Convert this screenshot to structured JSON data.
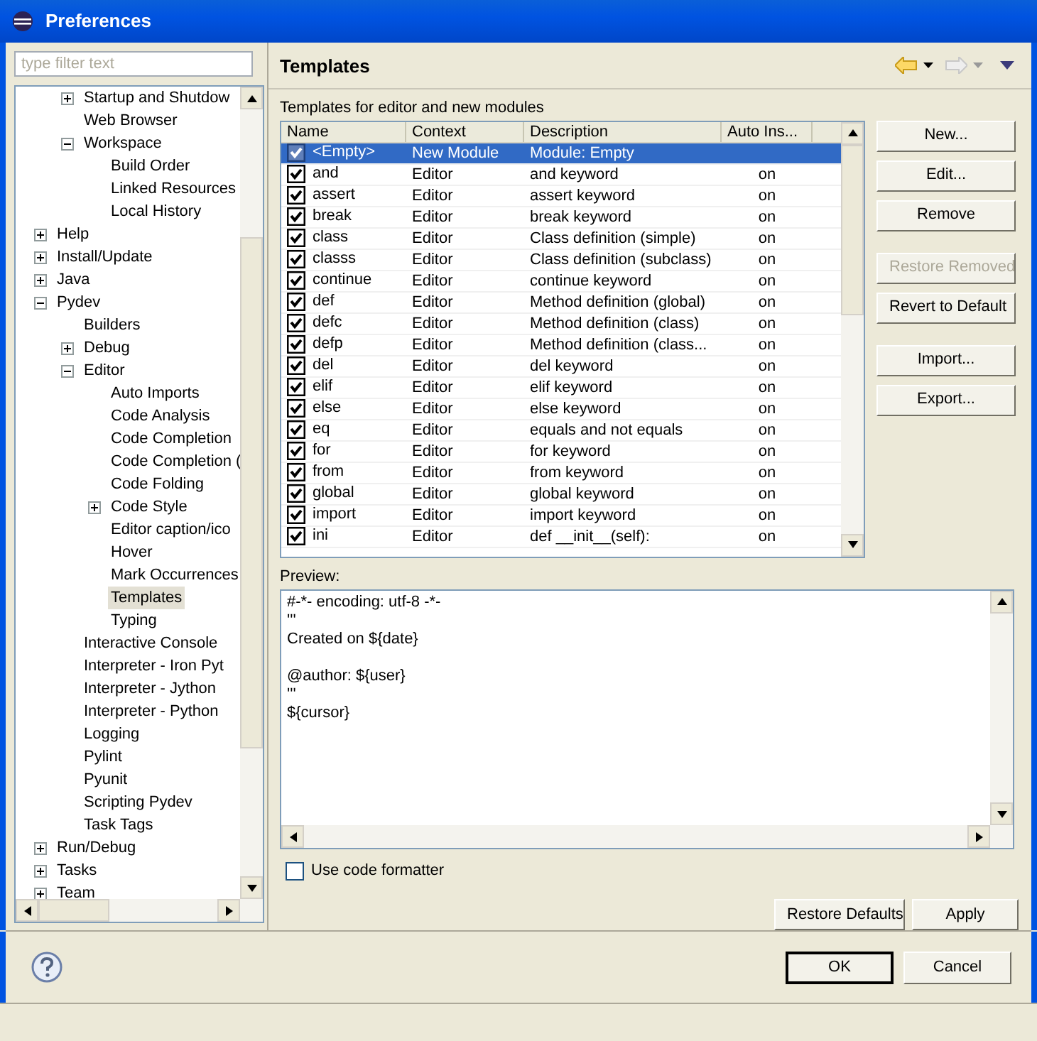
{
  "window": {
    "title": "Preferences"
  },
  "filter": {
    "placeholder": "type filter text"
  },
  "tree": [
    {
      "children": [
        {
          "label": "Startup and Shutdow",
          "expanded": false
        },
        {
          "label": "Web Browser"
        },
        {
          "label": "Workspace",
          "expanded": true,
          "children": [
            {
              "label": "Build Order"
            },
            {
              "label": "Linked Resources"
            },
            {
              "label": "Local History"
            }
          ]
        }
      ]
    },
    {
      "label": "Help",
      "expanded": false
    },
    {
      "label": "Install/Update",
      "expanded": false
    },
    {
      "label": "Java",
      "expanded": false
    },
    {
      "label": "Pydev",
      "expanded": true,
      "children": [
        {
          "label": "Builders"
        },
        {
          "label": "Debug",
          "expanded": false
        },
        {
          "label": "Editor",
          "expanded": true,
          "children": [
            {
              "label": "Auto Imports",
              "selected": false
            },
            {
              "label": "Code Analysis",
              "selected": false
            },
            {
              "label": "Code Completion",
              "selected": false
            },
            {
              "label": "Code Completion (",
              "selected": false
            },
            {
              "label": "Code Folding",
              "selected": false
            },
            {
              "label": "Code Style",
              "expanded": false,
              "selected": false
            },
            {
              "label": "Editor caption/ico",
              "selected": false
            },
            {
              "label": "Hover",
              "selected": false
            },
            {
              "label": "Mark Occurrences",
              "selected": false
            },
            {
              "label": "Templates",
              "selected": true
            },
            {
              "label": "Typing",
              "selected": false
            }
          ]
        },
        {
          "label": "Interactive Console"
        },
        {
          "label": "Interpreter - Iron Pyt"
        },
        {
          "label": "Interpreter - Jython"
        },
        {
          "label": "Interpreter - Python"
        },
        {
          "label": "Logging"
        },
        {
          "label": "Pylint"
        },
        {
          "label": "Pyunit"
        },
        {
          "label": "Scripting Pydev"
        },
        {
          "label": "Task Tags"
        }
      ]
    },
    {
      "label": "Run/Debug",
      "expanded": false
    },
    {
      "label": "Tasks",
      "expanded": false
    },
    {
      "label": "Team",
      "expanded": false
    }
  ],
  "page": {
    "title": "Templates",
    "description": "Templates for editor and new modules"
  },
  "table": {
    "columns": [
      "Name",
      "Context",
      "Description",
      "Auto Ins..."
    ],
    "rows": [
      {
        "name": "<Empty>",
        "context": "New Module",
        "description": "Module: Empty",
        "auto": "",
        "checked": true,
        "selected": true
      },
      {
        "name": "and",
        "context": "Editor",
        "description": "and keyword",
        "auto": "on",
        "checked": true,
        "selected": false
      },
      {
        "name": "assert",
        "context": "Editor",
        "description": "assert keyword",
        "auto": "on",
        "checked": true,
        "selected": false
      },
      {
        "name": "break",
        "context": "Editor",
        "description": "break keyword",
        "auto": "on",
        "checked": true,
        "selected": false
      },
      {
        "name": "class",
        "context": "Editor",
        "description": "Class definition (simple)",
        "auto": "on",
        "checked": true,
        "selected": false
      },
      {
        "name": "classs",
        "context": "Editor",
        "description": "Class definition (subclass)",
        "auto": "on",
        "checked": true,
        "selected": false
      },
      {
        "name": "continue",
        "context": "Editor",
        "description": "continue keyword",
        "auto": "on",
        "checked": true,
        "selected": false
      },
      {
        "name": "def",
        "context": "Editor",
        "description": "Method definition (global)",
        "auto": "on",
        "checked": true,
        "selected": false
      },
      {
        "name": "defc",
        "context": "Editor",
        "description": "Method definition (class)",
        "auto": "on",
        "checked": true,
        "selected": false
      },
      {
        "name": "defp",
        "context": "Editor",
        "description": "Method definition (class...",
        "auto": "on",
        "checked": true,
        "selected": false
      },
      {
        "name": "del",
        "context": "Editor",
        "description": "del keyword",
        "auto": "on",
        "checked": true,
        "selected": false
      },
      {
        "name": "elif",
        "context": "Editor",
        "description": "elif keyword",
        "auto": "on",
        "checked": true,
        "selected": false
      },
      {
        "name": "else",
        "context": "Editor",
        "description": "else keyword",
        "auto": "on",
        "checked": true,
        "selected": false
      },
      {
        "name": "eq",
        "context": "Editor",
        "description": "equals and not equals",
        "auto": "on",
        "checked": true,
        "selected": false
      },
      {
        "name": "for",
        "context": "Editor",
        "description": "for keyword",
        "auto": "on",
        "checked": true,
        "selected": false
      },
      {
        "name": "from",
        "context": "Editor",
        "description": "from keyword",
        "auto": "on",
        "checked": true,
        "selected": false
      },
      {
        "name": "global",
        "context": "Editor",
        "description": "global keyword",
        "auto": "on",
        "checked": true,
        "selected": false
      },
      {
        "name": "import",
        "context": "Editor",
        "description": "import keyword",
        "auto": "on",
        "checked": true,
        "selected": false
      },
      {
        "name": "ini",
        "context": "Editor",
        "description": "def __init__(self):",
        "auto": "on",
        "checked": true,
        "selected": false
      }
    ]
  },
  "side_button_groups": [
    [
      {
        "label": "New...",
        "disabled": false
      },
      {
        "label": "Edit...",
        "disabled": false
      },
      {
        "label": "Remove",
        "disabled": false
      }
    ],
    [
      {
        "label": "Restore Removed",
        "disabled": true
      },
      {
        "label": "Revert to Default",
        "disabled": false
      }
    ],
    [
      {
        "label": "Import...",
        "disabled": false
      },
      {
        "label": "Export...",
        "disabled": false
      }
    ]
  ],
  "preview": {
    "label": "Preview:",
    "text": "#-*- encoding: utf-8 -*-\n'''\nCreated on ${date}\n\n@author: ${user}\n'''\n${cursor}"
  },
  "use_code_formatter": {
    "label": "Use code formatter",
    "checked": false
  },
  "page_buttons": [
    "Restore Defaults",
    "Apply"
  ],
  "dialog_buttons": [
    {
      "label": "OK",
      "default": true
    },
    {
      "label": "Cancel",
      "default": false
    }
  ]
}
